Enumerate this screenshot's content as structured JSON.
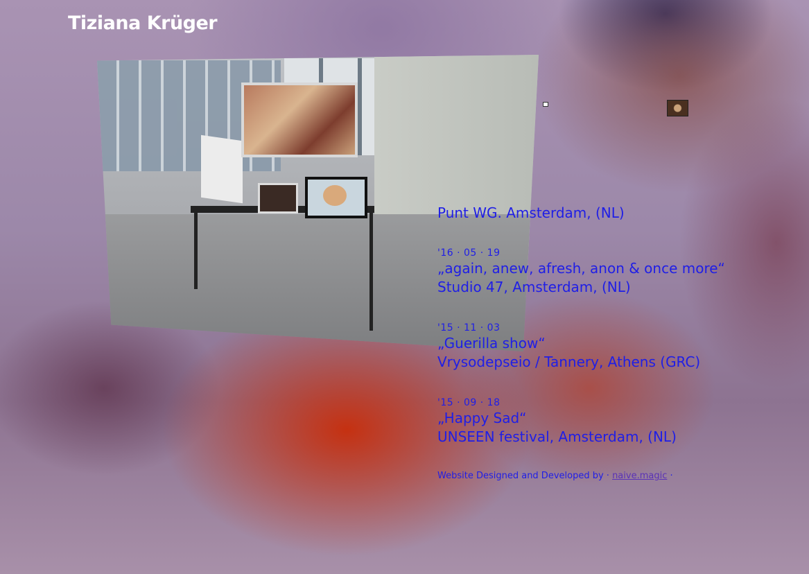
{
  "site_title": "Tiziana Krüger",
  "events": [
    {
      "date": "",
      "title": "",
      "venue": "Punt WG. Amsterdam, (NL)"
    },
    {
      "date": "'16 · 05 · 19",
      "title": "„again, anew, afresh, anon & once more“",
      "venue": "Studio 47, Amsterdam, (NL)"
    },
    {
      "date": "'15 · 11 · 03",
      "title": "„Guerilla show“",
      "venue": "Vrysodepseio / Tannery, Athens (GRC)"
    },
    {
      "date": "'15 · 09 · 18",
      "title": "„Happy Sad“",
      "venue": "UNSEEN festival, Amsterdam, (NL)"
    }
  ],
  "footer": {
    "text": "Website Designed and Developed by ·",
    "link_label": "naive.magic",
    "suffix": "·"
  },
  "colors": {
    "text_accent": "#1f1ee6",
    "link": "#5a32b6",
    "title": "#ffffff"
  }
}
